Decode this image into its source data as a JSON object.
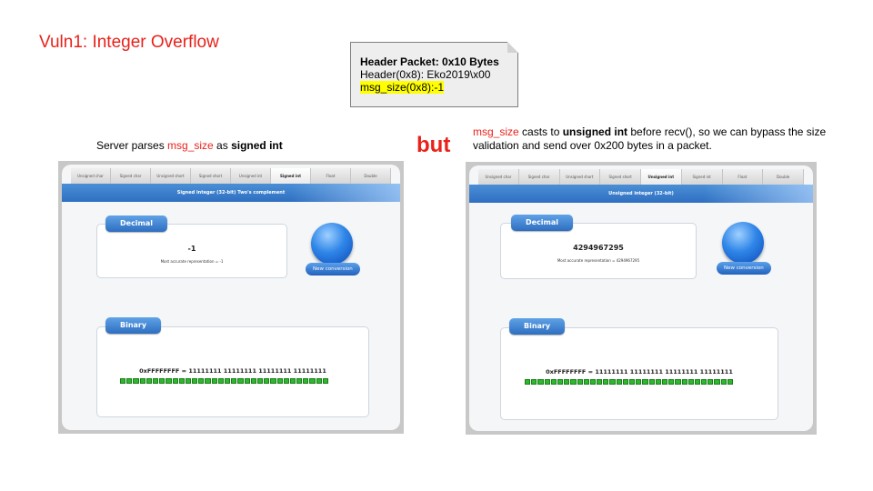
{
  "slide": {
    "title": "Vuln1: Integer Overflow"
  },
  "note": {
    "title": "Header Packet: 0x10 Bytes",
    "line1": "Header(0x8): Eko2019\\x00",
    "line2": "msg_size(0x8):-1"
  },
  "left_caption": {
    "prefix": "Server parses ",
    "term": "msg_size",
    "middle": " as ",
    "type": "signed int"
  },
  "but_label": "but",
  "right_caption": {
    "term": "msg_size",
    "middle": " casts to ",
    "type": "unsigned int",
    "rest": " before recv(), so we can bypass the size validation and send over 0x200 bytes in a packet."
  },
  "left_calc": {
    "tabs": [
      "Unsigned char",
      "Signed char",
      "Unsigned short",
      "Signed short",
      "Unsigned int",
      "Signed int",
      "Float",
      "Double"
    ],
    "active_tab": 5,
    "banner": "Signed integer (32-bit) Two's complement",
    "decimal_label": "Decimal",
    "decimal_value": "-1",
    "decimal_sub": "Most accurate representation = -1",
    "new_conversion": "New conversion",
    "binary_label": "Binary",
    "binary_value": "0xFFFFFFFF = 11111111 11111111 11111111 11111111"
  },
  "right_calc": {
    "tabs": [
      "Unsigned char",
      "Signed char",
      "Unsigned short",
      "Signed short",
      "Unsigned int",
      "Signed int",
      "Float",
      "Double"
    ],
    "active_tab": 4,
    "banner": "Unsigned integer (32-bit)",
    "decimal_label": "Decimal",
    "decimal_value": "4294967295",
    "decimal_sub": "Most accurate representation = 4294967295",
    "new_conversion": "New conversion",
    "binary_label": "Binary",
    "binary_value": "0xFFFFFFFF = 11111111 11111111 11111111 11111111"
  },
  "colors": {
    "accent_red": "#e8221b",
    "highlight": "#ffff00",
    "bit_green": "#2eb82e"
  }
}
